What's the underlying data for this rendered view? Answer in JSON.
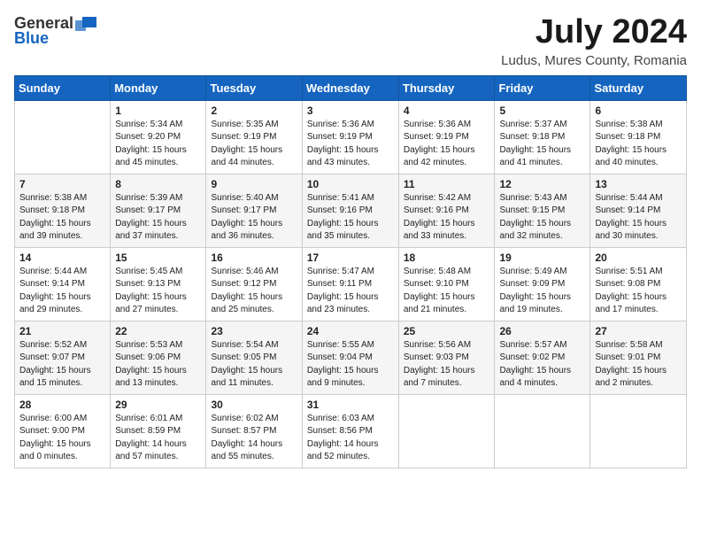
{
  "header": {
    "logo_general": "General",
    "logo_blue": "Blue",
    "month_year": "July 2024",
    "location": "Ludus, Mures County, Romania"
  },
  "days_of_week": [
    "Sunday",
    "Monday",
    "Tuesday",
    "Wednesday",
    "Thursday",
    "Friday",
    "Saturday"
  ],
  "weeks": [
    [
      {
        "day": "",
        "info": ""
      },
      {
        "day": "1",
        "info": "Sunrise: 5:34 AM\nSunset: 9:20 PM\nDaylight: 15 hours\nand 45 minutes."
      },
      {
        "day": "2",
        "info": "Sunrise: 5:35 AM\nSunset: 9:19 PM\nDaylight: 15 hours\nand 44 minutes."
      },
      {
        "day": "3",
        "info": "Sunrise: 5:36 AM\nSunset: 9:19 PM\nDaylight: 15 hours\nand 43 minutes."
      },
      {
        "day": "4",
        "info": "Sunrise: 5:36 AM\nSunset: 9:19 PM\nDaylight: 15 hours\nand 42 minutes."
      },
      {
        "day": "5",
        "info": "Sunrise: 5:37 AM\nSunset: 9:18 PM\nDaylight: 15 hours\nand 41 minutes."
      },
      {
        "day": "6",
        "info": "Sunrise: 5:38 AM\nSunset: 9:18 PM\nDaylight: 15 hours\nand 40 minutes."
      }
    ],
    [
      {
        "day": "7",
        "info": "Sunrise: 5:38 AM\nSunset: 9:18 PM\nDaylight: 15 hours\nand 39 minutes."
      },
      {
        "day": "8",
        "info": "Sunrise: 5:39 AM\nSunset: 9:17 PM\nDaylight: 15 hours\nand 37 minutes."
      },
      {
        "day": "9",
        "info": "Sunrise: 5:40 AM\nSunset: 9:17 PM\nDaylight: 15 hours\nand 36 minutes."
      },
      {
        "day": "10",
        "info": "Sunrise: 5:41 AM\nSunset: 9:16 PM\nDaylight: 15 hours\nand 35 minutes."
      },
      {
        "day": "11",
        "info": "Sunrise: 5:42 AM\nSunset: 9:16 PM\nDaylight: 15 hours\nand 33 minutes."
      },
      {
        "day": "12",
        "info": "Sunrise: 5:43 AM\nSunset: 9:15 PM\nDaylight: 15 hours\nand 32 minutes."
      },
      {
        "day": "13",
        "info": "Sunrise: 5:44 AM\nSunset: 9:14 PM\nDaylight: 15 hours\nand 30 minutes."
      }
    ],
    [
      {
        "day": "14",
        "info": "Sunrise: 5:44 AM\nSunset: 9:14 PM\nDaylight: 15 hours\nand 29 minutes."
      },
      {
        "day": "15",
        "info": "Sunrise: 5:45 AM\nSunset: 9:13 PM\nDaylight: 15 hours\nand 27 minutes."
      },
      {
        "day": "16",
        "info": "Sunrise: 5:46 AM\nSunset: 9:12 PM\nDaylight: 15 hours\nand 25 minutes."
      },
      {
        "day": "17",
        "info": "Sunrise: 5:47 AM\nSunset: 9:11 PM\nDaylight: 15 hours\nand 23 minutes."
      },
      {
        "day": "18",
        "info": "Sunrise: 5:48 AM\nSunset: 9:10 PM\nDaylight: 15 hours\nand 21 minutes."
      },
      {
        "day": "19",
        "info": "Sunrise: 5:49 AM\nSunset: 9:09 PM\nDaylight: 15 hours\nand 19 minutes."
      },
      {
        "day": "20",
        "info": "Sunrise: 5:51 AM\nSunset: 9:08 PM\nDaylight: 15 hours\nand 17 minutes."
      }
    ],
    [
      {
        "day": "21",
        "info": "Sunrise: 5:52 AM\nSunset: 9:07 PM\nDaylight: 15 hours\nand 15 minutes."
      },
      {
        "day": "22",
        "info": "Sunrise: 5:53 AM\nSunset: 9:06 PM\nDaylight: 15 hours\nand 13 minutes."
      },
      {
        "day": "23",
        "info": "Sunrise: 5:54 AM\nSunset: 9:05 PM\nDaylight: 15 hours\nand 11 minutes."
      },
      {
        "day": "24",
        "info": "Sunrise: 5:55 AM\nSunset: 9:04 PM\nDaylight: 15 hours\nand 9 minutes."
      },
      {
        "day": "25",
        "info": "Sunrise: 5:56 AM\nSunset: 9:03 PM\nDaylight: 15 hours\nand 7 minutes."
      },
      {
        "day": "26",
        "info": "Sunrise: 5:57 AM\nSunset: 9:02 PM\nDaylight: 15 hours\nand 4 minutes."
      },
      {
        "day": "27",
        "info": "Sunrise: 5:58 AM\nSunset: 9:01 PM\nDaylight: 15 hours\nand 2 minutes."
      }
    ],
    [
      {
        "day": "28",
        "info": "Sunrise: 6:00 AM\nSunset: 9:00 PM\nDaylight: 15 hours\nand 0 minutes."
      },
      {
        "day": "29",
        "info": "Sunrise: 6:01 AM\nSunset: 8:59 PM\nDaylight: 14 hours\nand 57 minutes."
      },
      {
        "day": "30",
        "info": "Sunrise: 6:02 AM\nSunset: 8:57 PM\nDaylight: 14 hours\nand 55 minutes."
      },
      {
        "day": "31",
        "info": "Sunrise: 6:03 AM\nSunset: 8:56 PM\nDaylight: 14 hours\nand 52 minutes."
      },
      {
        "day": "",
        "info": ""
      },
      {
        "day": "",
        "info": ""
      },
      {
        "day": "",
        "info": ""
      }
    ]
  ]
}
